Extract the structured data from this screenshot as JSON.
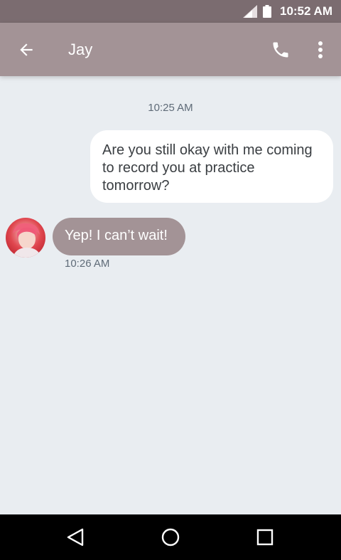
{
  "status_bar": {
    "time": "10:52 AM",
    "icons": [
      "signal-icon",
      "battery-icon"
    ]
  },
  "app_bar": {
    "contact_name": "Jay",
    "icons": [
      "back-arrow-icon",
      "phone-icon",
      "more-vert-icon"
    ]
  },
  "conversation": {
    "date_separator": "10:25 AM",
    "messages": [
      {
        "direction": "outgoing",
        "text": "Are you still okay with me coming to record you at practice tomorrow?"
      },
      {
        "direction": "incoming",
        "text": "Yep! I can’t wait!",
        "time": "10:26 AM"
      }
    ]
  },
  "nav_bar": {
    "icons": [
      "back-triangle-icon",
      "home-circle-icon",
      "recents-square-icon"
    ]
  },
  "colors": {
    "status_bar": "#7b6c70",
    "app_bar": "#a39396",
    "background": "#e9edf1",
    "incoming_bubble": "#a39396",
    "outgoing_bubble": "#ffffff"
  }
}
